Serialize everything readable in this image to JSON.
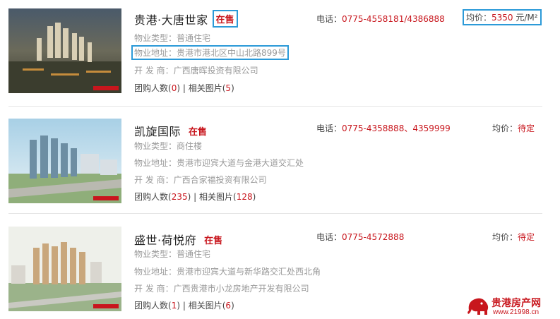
{
  "listings": [
    {
      "name": "贵港·大唐世家",
      "status": "在售",
      "type_label": "物业类型：",
      "type_value": "普通住宅",
      "address_label": "物业地址：",
      "address_value": "贵港市港北区中山北路899号",
      "developer_label": "开 发 商：",
      "developer_value": "广西唐晖投资有限公司",
      "group_label": "团购人数",
      "group_count": "0",
      "photos_label": "相关图片",
      "photos_count": "5",
      "phone_label": "电话：",
      "phone_value": "0775-4558181/4386888",
      "price_label": "均价：",
      "price_value": "5350",
      "price_unit": "元/M²"
    },
    {
      "name": "凯旋国际",
      "status": "在售",
      "type_label": "物业类型：",
      "type_value": "商住楼",
      "address_label": "物业地址：",
      "address_value": "贵港市迎宾大道与金港大道交汇处",
      "developer_label": "开 发 商：",
      "developer_value": "广西合家福投资有限公司",
      "group_label": "团购人数",
      "group_count": "235",
      "photos_label": "相关图片",
      "photos_count": "128",
      "phone_label": "电话：",
      "phone_value": "0775-4358888、4359999",
      "price_label": "均价：",
      "price_value": "待定",
      "price_unit": ""
    },
    {
      "name": "盛世·荷悦府",
      "status": "在售",
      "type_label": "物业类型：",
      "type_value": "普通住宅",
      "address_label": "物业地址：",
      "address_value": "贵港市迎宾大道与新华路交汇处西北角",
      "developer_label": "开 发 商：",
      "developer_value": "广西贵港市小龙房地产开发有限公司",
      "group_label": "团购人数",
      "group_count": "1",
      "photos_label": "相关图片",
      "photos_count": "6",
      "phone_label": "电话：",
      "phone_value": "0775-4572888",
      "price_label": "均价：",
      "price_value": "待定",
      "price_unit": ""
    }
  ],
  "watermark": {
    "site_name": "贵港房产网",
    "url": "www.21998.cn"
  },
  "colors": {
    "accent_red": "#c8161d",
    "highlight_blue": "#2c9ad8",
    "muted_text": "#999999"
  }
}
